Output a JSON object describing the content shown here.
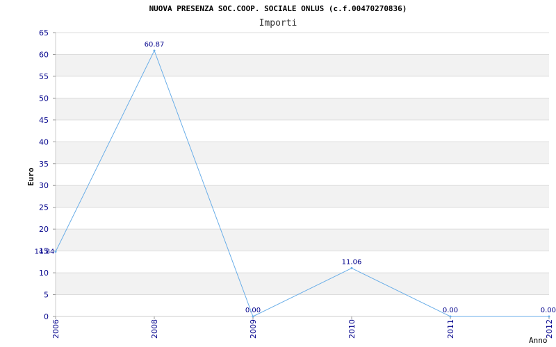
{
  "chart_data": {
    "type": "line",
    "title": "NUOVA PRESENZA SOC.COOP. SOCIALE ONLUS (c.f.00470270836)",
    "subtitle": "Importi",
    "xlabel": "Anno",
    "ylabel": "Euro",
    "x": [
      "2006",
      "2008",
      "2009",
      "2010",
      "2011",
      "2012"
    ],
    "values": [
      14.84,
      60.87,
      0.0,
      11.06,
      0.0,
      0.0
    ],
    "data_labels": [
      "14.84",
      "60.87",
      "0.00",
      "11.06",
      "0.00",
      "0.00"
    ],
    "ylim": [
      0,
      65
    ],
    "yticks": [
      0,
      5,
      10,
      15,
      20,
      25,
      30,
      35,
      40,
      45,
      50,
      55,
      60,
      65
    ],
    "grid": "horizontal alternating bands",
    "colors": {
      "line": "#6aaee8",
      "label": "#00008b",
      "band": "#f2f2f2",
      "gridline": "#dddddd"
    }
  }
}
